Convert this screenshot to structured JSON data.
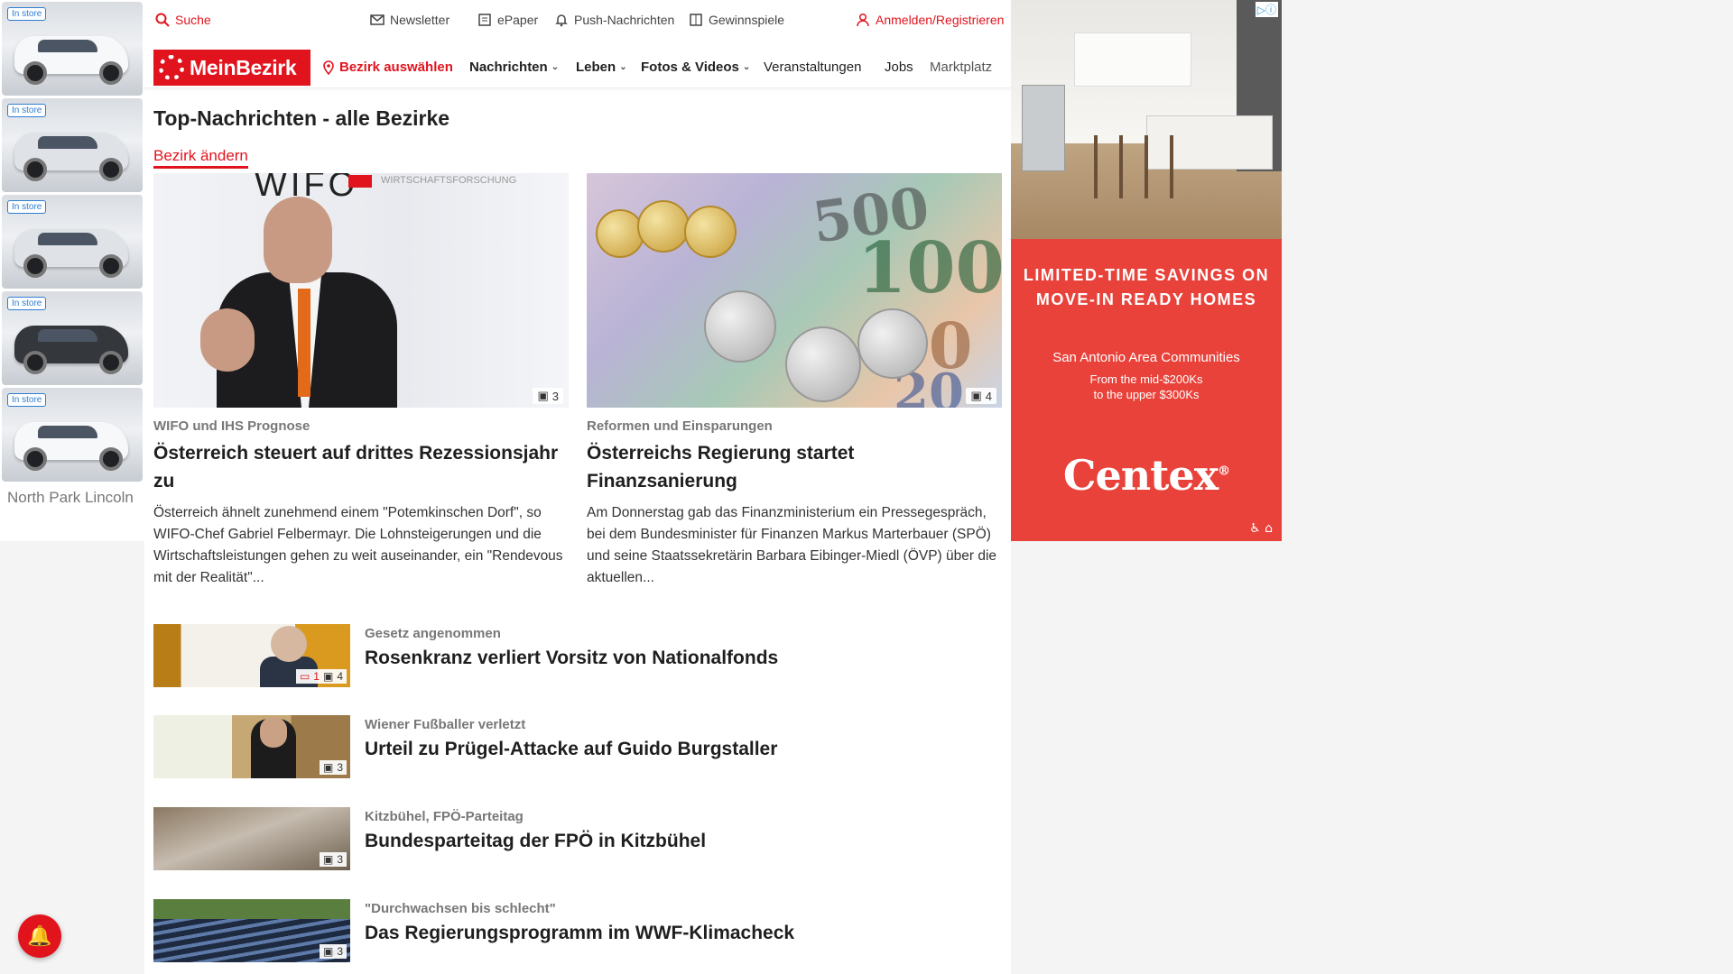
{
  "left_ad": {
    "badges": [
      "In store",
      "In store",
      "In store",
      "In store",
      "In store"
    ],
    "advertiser": "North Park Lincoln",
    "adchoice": "▷ⓘ"
  },
  "utility_bar": {
    "search": "Suche",
    "newsletter": "Newsletter",
    "epaper": "ePaper",
    "push": "Push-Nachrichten",
    "gewinnspiele": "Gewinnspiele",
    "login": "Anmelden/Registrieren"
  },
  "navbar": {
    "logo_text": "MeinBezirk",
    "bezirk": "Bezirk auswählen",
    "items": [
      "Nachrichten",
      "Leben",
      "Fotos & Videos",
      "Veranstaltungen",
      "Jobs",
      "Marktplatz"
    ]
  },
  "page": {
    "section_title": "Top-Nachrichten - alle Bezirke",
    "change_bezirk": "Bezirk ändern"
  },
  "top_articles": [
    {
      "image_text": "WIFO",
      "image_text_small": "WIRTSCHAFTSFORSCHUNG",
      "photo_count": "3",
      "kicker": "WIFO und IHS Prognose",
      "title": "Österreich steuert auf drittes Rezessionsjahr zu",
      "teaser": "Österreich ähnelt zunehmend einem \"Potemkinschen Dorf\", so WIFO-Chef Gabriel Felbermayr. Die Lohnsteigerungen und die Wirtschaftsleistungen gehen zu weit auseinander, ein \"Rendevous mit der Realität\"..."
    },
    {
      "image_notes": [
        "500",
        "100",
        "50",
        "20"
      ],
      "photo_count": "4",
      "kicker": "Reformen und Einsparungen",
      "title": "Österreichs Regierung startet Finanzsanierung",
      "teaser": "Am Donnerstag gab das Finanzministerium ein Pressegespräch, bei dem Bundesminister für Finanzen Markus Marterbauer (SPÖ) und seine Staatssekretärin Barbara Eibinger-Miedl (ÖVP) über die aktuellen..."
    }
  ],
  "list_articles": [
    {
      "kicker": "Gesetz angenommen",
      "title": "Rosenkranz verliert Vorsitz von Nationalfonds",
      "comments": "1",
      "photo_count": "4"
    },
    {
      "kicker": "Wiener Fußballer verletzt",
      "title": "Urteil zu Prügel-Attacke auf Guido Burgstaller",
      "photo_count": "3"
    },
    {
      "kicker": "Kitzbühel, FPÖ-Parteitag",
      "title": "Bundesparteitag der FPÖ in Kitzbühel",
      "photo_count": "3"
    },
    {
      "kicker": "\"Durchwachsen bis schlecht\"",
      "title": "Das Regierungsprogramm im WWF-Klimacheck",
      "photo_count": "3"
    }
  ],
  "right_ad": {
    "headline_1": "LIMITED-TIME SAVINGS ON",
    "headline_2": "MOVE-IN READY HOMES",
    "sub": "San Antonio Area Communities",
    "price_1": "From the mid-$200Ks",
    "price_2": "to the upper $300Ks",
    "brand": "Centex",
    "brand_mark": "®",
    "adchoice": "▷ⓘ"
  },
  "colors": {
    "brand_red": "#e1141e",
    "ad_red": "#e8423a"
  }
}
